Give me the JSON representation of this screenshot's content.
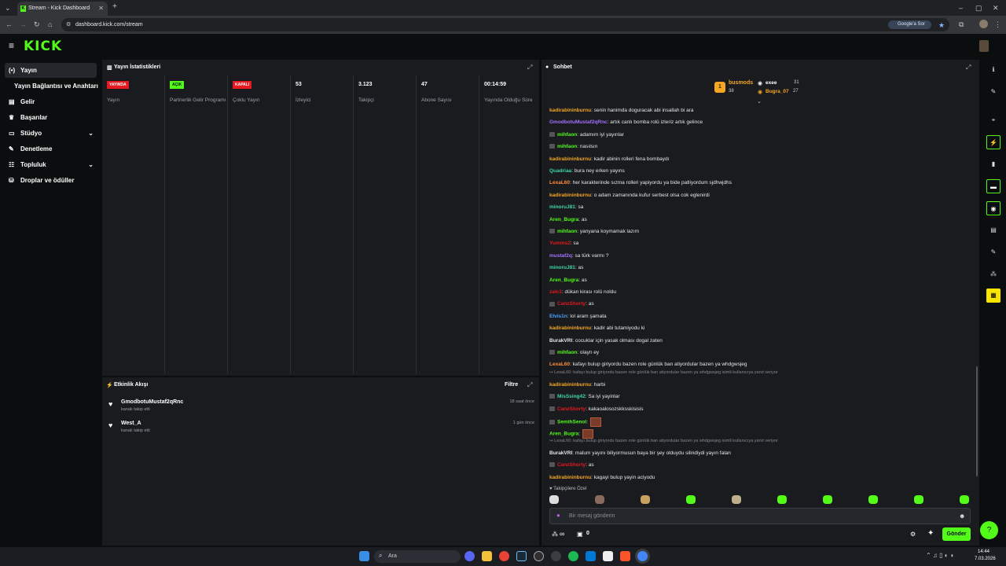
{
  "browser": {
    "tab_title": "Stream - Kick Dashboard",
    "tab_favicon": "K",
    "url": "dashboard.kick.com/stream",
    "search_chip": "Google'a Sor",
    "new_tab": "+",
    "minimize": "–",
    "maximize": "▢",
    "close": "✕"
  },
  "app": {
    "logo": "KICK",
    "brand_color": "#53fc18"
  },
  "nav": {
    "items": [
      {
        "label": "Yayın",
        "icon": "broadcast-icon",
        "glyph": "(•)"
      },
      {
        "label": "Yayın Bağlantısı ve Anahtarı",
        "icon": "",
        "glyph": ""
      },
      {
        "label": "Gelir",
        "icon": "wallet-icon",
        "glyph": "▤"
      },
      {
        "label": "Başarılar",
        "icon": "trophy-icon",
        "glyph": "♛"
      },
      {
        "label": "Stüdyo",
        "icon": "studio-icon",
        "glyph": "▭",
        "chevron": "⌄"
      },
      {
        "label": "Denetleme",
        "icon": "wrench-icon",
        "glyph": "✎"
      },
      {
        "label": "Topluluk",
        "icon": "community-icon",
        "glyph": "☷",
        "chevron": "⌄"
      },
      {
        "label": "Droplar ve ödüller",
        "icon": "gift-icon",
        "glyph": "⛁"
      }
    ]
  },
  "stats": {
    "title": "Yayın İstatistikleri",
    "columns": [
      {
        "badge": "YAYINDA",
        "badge_color": "#e5191f",
        "label": "Yayın"
      },
      {
        "badge": "AÇIK",
        "badge_color": "#53fc18",
        "label": "Partnerlik Gelir Programı"
      },
      {
        "badge": "KAPALI",
        "badge_color": "#e5191f",
        "label": "Çoklu Yayın"
      },
      {
        "value": "53",
        "label": "İzleyici"
      },
      {
        "value": "3.123",
        "label": "Takipçi"
      },
      {
        "value": "47",
        "label": "Abone Sayısı"
      },
      {
        "value": "00:14:59",
        "label": "Yayında Olduğu Süre"
      }
    ]
  },
  "activity": {
    "title": "Etkinlik Akışı",
    "filter": "Filtre",
    "rows": [
      {
        "name": "GmodbotuMustaf2qRnc",
        "sub": "kanalı takip etti",
        "time": "18 saat önce"
      },
      {
        "name": "West_A",
        "sub": "kanalı takip etti",
        "time": "1 gün önce"
      }
    ]
  },
  "chat": {
    "title": "Sohbet",
    "leaderboard": [
      {
        "rank": "1",
        "name": "busmods",
        "count": "38"
      },
      {
        "name": "exee",
        "count": "31"
      },
      {
        "name": "Bugra_07",
        "count": "27"
      }
    ],
    "messages": [
      {
        "user": "kadirabininburnu",
        "color": "#f5a623",
        "text": "senin hanimda doguracak abi insallah bi ara"
      },
      {
        "user": "GmodbotuMustaf2qRnc",
        "color": "#a970ff",
        "text": "artık canlı bomba rolü izleriz artık gelince"
      },
      {
        "user": "mihfaon",
        "color": "#53fc18",
        "text": "adamım iyi yayınlar",
        "badge": true
      },
      {
        "user": "mihfaon",
        "color": "#53fc18",
        "text": "nasılsın",
        "badge": true
      },
      {
        "user": "kadirabininburnu",
        "color": "#f5a623",
        "text": "kadir abinin rolleri fena bombaydı"
      },
      {
        "user": "Quadriaa",
        "color": "#3fd6a5",
        "text": "bura ney erken yayıns"
      },
      {
        "user": "LexaL60",
        "color": "#ff8c3a",
        "text": "her karakterinde sızma rolleri yapiyordu ya bide patliyordum sjdhwjdhs"
      },
      {
        "user": "kadirabininburnu",
        "color": "#f5a623",
        "text": "o adam zamanında kufur serbest olsa cok eglenirdi"
      },
      {
        "user": "minoruJ81",
        "color": "#3fd6a5",
        "text": "sa"
      },
      {
        "user": "Aren_Bugra",
        "color": "#53fc18",
        "text": "as"
      },
      {
        "user": "mihfaon",
        "color": "#53fc18",
        "text": "yanyana koymamak lazım",
        "badge": true
      },
      {
        "user": "Yumms2",
        "color": "#e5191f",
        "text": "sa"
      },
      {
        "user": "mustaf2q",
        "color": "#a970ff",
        "text": "sa türk varmı ?"
      },
      {
        "user": "minoruJ81",
        "color": "#3fd6a5",
        "text": "as"
      },
      {
        "user": "Aren_Bugra",
        "color": "#53fc18",
        "text": "as"
      },
      {
        "user": "zalc1",
        "color": "#e5191f",
        "text": "dükan kirası rolü noldu"
      },
      {
        "user": "CanzShorty",
        "color": "#e5191f",
        "text": "as",
        "badge": true
      },
      {
        "user": "Elvis1n",
        "color": "#4aa3ff",
        "text": "lol aram şamata"
      },
      {
        "user": "kadirabininburnu",
        "color": "#f5a623",
        "text": "kadir abi tutamiyodu ki"
      },
      {
        "user": "BurakVRI",
        "color": "#e6e6e6",
        "text": "cocuklar için yasak olması dogal zaten"
      },
      {
        "user": "mihfaon",
        "color": "#53fc18",
        "text": "olayn ey",
        "badge": true
      },
      {
        "user": "LexaL60",
        "color": "#ff8c3a",
        "text": "kafayı bulup giriyordu bazen role günlük ban atiyordular bazen ya whdgwsjeg"
      },
      {
        "reply": "↪ LexaL60: kafayı bulup giriyordu bazen role günlük ban atiyordular bazen ya whdgwsjeg isimli kullanıcıya yanıt veriyor"
      },
      {
        "user": "kadirabininburnu",
        "color": "#f5a623",
        "text": "harbi"
      },
      {
        "user": "MisSsing42",
        "color": "#3fd6a5",
        "text": "Sa iyi yayinlar",
        "badge": true
      },
      {
        "user": "CanzShorty",
        "color": "#e5191f",
        "text": "kakaoalosozskksskisisis",
        "badge": true
      },
      {
        "user": "SemihSenol",
        "color": "#53fc18",
        "text": "",
        "badge": true,
        "emote": true
      },
      {
        "user": "Aren_Bugra",
        "color": "#53fc18",
        "text": "",
        "emote": true
      },
      {
        "reply": "↪ LexaL60: kafayı bulup giriyordu bazen role günlük ban atiyordular bazen ya whdgwsjeg isimli kullanıcıya yanıt veriyor"
      },
      {
        "user": "BurakVRI",
        "color": "#e6e6e6",
        "text": "malum yayını biliyormusun baya bir şey olduydu silindiydi yayın falan"
      },
      {
        "user": "CanzShorty",
        "color": "#e5191f",
        "text": "as",
        "badge": true
      },
      {
        "user": "kadirabininburnu",
        "color": "#f5a623",
        "text": "kagayi bulup yayin aciyodu"
      }
    ],
    "followers_only": "♥ Takipçilere Özel",
    "input_placeholder": "Bir mesaj gönderin",
    "points": "∞",
    "count": "0",
    "send": "Gönder"
  },
  "taskbar": {
    "search": "Ara",
    "time": "14:44",
    "date": "7.03.2026"
  }
}
